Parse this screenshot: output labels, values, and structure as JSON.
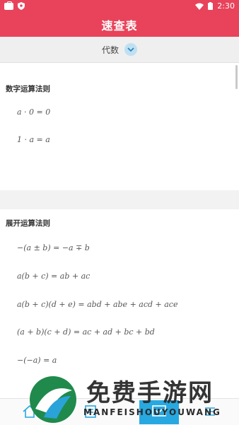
{
  "status": {
    "time": "2:30"
  },
  "header": {
    "title": "速查表"
  },
  "category": {
    "label": "代数"
  },
  "sections": [
    {
      "title": "数字运算法则",
      "formulas": [
        "a · 0 = 0",
        "1 · a = a"
      ]
    },
    {
      "title": "展开运算法则",
      "formulas": [
        "−(a ± b) = −a ∓ b",
        "a(b + c) = ab + ac",
        "a(b + c)(d + e) = abd + abe + acd + ace",
        "(a + b)(c + d) = ac + ad + bc + bd",
        "−(−a) = a"
      ]
    }
  ],
  "watermark": {
    "main": "免费手游网",
    "sub": "MANFEISHOUYOUWANG"
  },
  "colors": {
    "primary": "#e8435a",
    "accent": "#28a8e0"
  }
}
